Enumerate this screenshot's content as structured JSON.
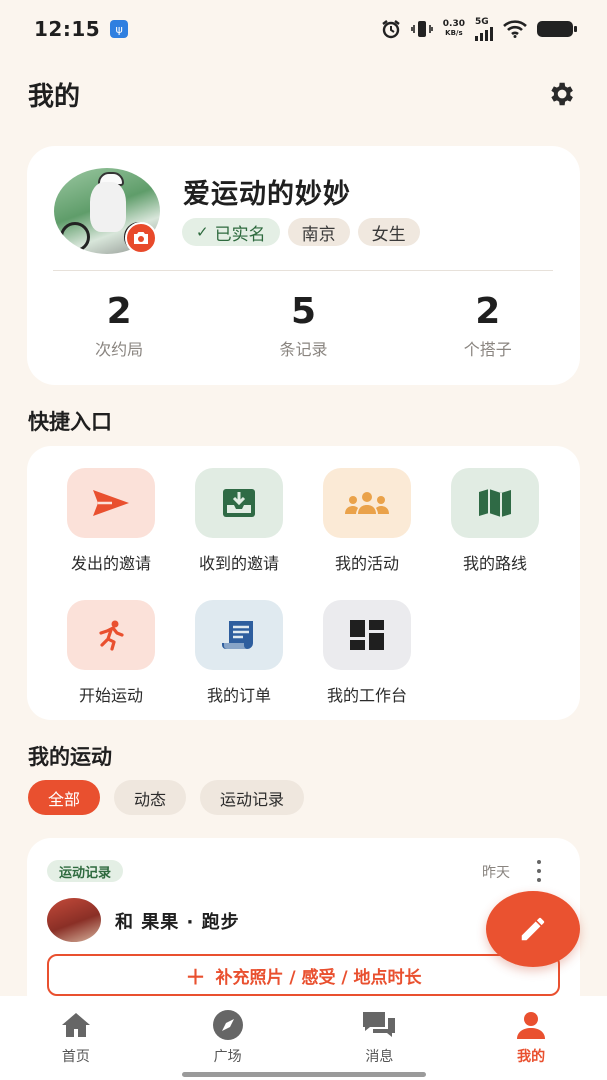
{
  "status_bar": {
    "time": "12:15",
    "net_speed_value": "0.30",
    "net_speed_unit": "KB/s",
    "network": "5G"
  },
  "header": {
    "title": "我的"
  },
  "profile": {
    "nickname": "爱运动的妙妙",
    "tags": [
      "已实名",
      "南京",
      "女生"
    ],
    "stats": [
      {
        "value": "2",
        "label": "次约局"
      },
      {
        "value": "5",
        "label": "条记录"
      },
      {
        "value": "2",
        "label": "个搭子"
      }
    ]
  },
  "quick_entry": {
    "title": "快捷入口",
    "items": [
      {
        "label": "发出的邀请",
        "icon": "send-icon"
      },
      {
        "label": "收到的邀请",
        "icon": "inbox-icon"
      },
      {
        "label": "我的活动",
        "icon": "group-icon"
      },
      {
        "label": "我的路线",
        "icon": "map-icon"
      },
      {
        "label": "开始运动",
        "icon": "run-icon"
      },
      {
        "label": "我的订单",
        "icon": "receipt-icon"
      },
      {
        "label": "我的工作台",
        "icon": "dashboard-icon"
      }
    ]
  },
  "my_sports": {
    "title": "我的运动",
    "filters": [
      "全部",
      "动态",
      "运动记录"
    ],
    "active_filter": "全部"
  },
  "record": {
    "tag": "运动记录",
    "time": "昨天",
    "title": "和 果果 · 跑步",
    "add_action": "补充照片 / 感受 / 地点时长"
  },
  "tabbar": {
    "tabs": [
      "首页",
      "广场",
      "消息",
      "我的"
    ],
    "active": "我的"
  },
  "colors": {
    "accent": "#e9502f",
    "background": "#fbf5ee",
    "verified_green": "#2e6a3e"
  }
}
